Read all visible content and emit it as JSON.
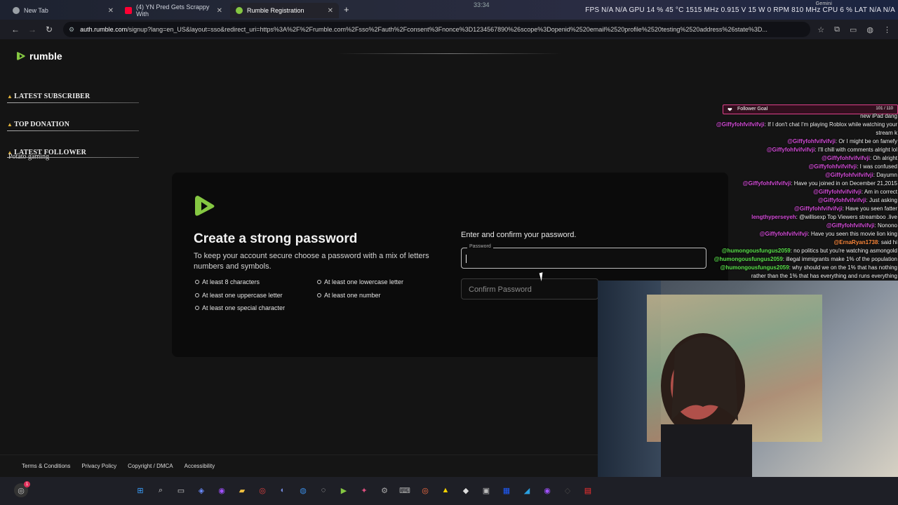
{
  "browser": {
    "tabs": [
      {
        "label": "New Tab",
        "color": "#9aa0a6"
      },
      {
        "label": "(4) YN Pred Gets Scrappy With",
        "color": "#ff0033"
      },
      {
        "label": "Rumble Registration",
        "color": "#85c742"
      }
    ],
    "url_host": "auth.rumble.com",
    "url_path": "/signup?lang=en_US&layout=sso&redirect_uri=https%3A%2F%2Frumble.com%2Fsso%2Fauth%2Fconsent%3Fnonce%3D1234567890%26scope%3Dopenid%2520email%2520profile%2520testing%2520address%26state%3D..."
  },
  "hud": {
    "text": "FPS N/A N/A   GPU 14 %  45 °C  1515 MHz  0.915 V  15 W  0 RPM  810 MHz   CPU  6 %   LAT N/A N/A",
    "gemini": "Gemini",
    "time": "33:34"
  },
  "rumble": {
    "brand": "rumble",
    "accent": "#85c742",
    "title": "Create a strong password",
    "description": "To keep your account secure choose a password with a mix of letters numbers and symbols.",
    "requirements": [
      "At least 8 characters",
      "At least one lowercase letter",
      "At least one uppercase letter",
      "At least one number",
      "At least one special character"
    ],
    "enter_label": "Enter and confirm your password.",
    "password_label": "Password",
    "password_value": "",
    "confirm_placeholder": "Confirm Password",
    "footer_links": [
      "Terms & Conditions",
      "Privacy Policy",
      "Copyright / DMCA",
      "Accessibility"
    ]
  },
  "overlay": {
    "latest_subscriber": "LATEST SUBSCRIBER",
    "top_donation": "TOP DONATION",
    "latest_follower": "LATEST FOLLOWER",
    "latest_follower_value": "Potato gaming"
  },
  "follower_goal": {
    "title": "Follower Goal",
    "count": "101 / 110"
  },
  "chat": [
    {
      "user": "",
      "text": "new iPad dang",
      "color": "#ffffff"
    },
    {
      "user": "@Giffyfohfvifvifvji",
      "text": ": If I don't chat I'm playing Roblox while watching your",
      "color": "#d24bd6"
    },
    {
      "user": "",
      "text": "stream k",
      "color": "#ffffff"
    },
    {
      "user": "@Giffyfohfvifvifvji",
      "text": ": Or I might be on famefy",
      "color": "#d24bd6"
    },
    {
      "user": "@Giffyfohfvifvifvji",
      "text": ": I'll chill with comments alright lol",
      "color": "#d24bd6"
    },
    {
      "user": "@Giffyfohfvifvifvji",
      "text": ": Oh alright",
      "color": "#d24bd6"
    },
    {
      "user": "@Giffyfohfvifvifvji",
      "text": ": I was confused",
      "color": "#d24bd6"
    },
    {
      "user": "@Giffyfohfvifvifvji",
      "text": ": Dayumn",
      "color": "#d24bd6"
    },
    {
      "user": "@Giffyfohfvifvifvji",
      "text": ": Have you joined in on December 21,2015",
      "color": "#d24bd6"
    },
    {
      "user": "@Giffyfohfvifvifvji",
      "text": ": Am in correct",
      "color": "#d24bd6"
    },
    {
      "user": "@Giffyfohfvifvifvji",
      "text": ": Just asking",
      "color": "#d24bd6"
    },
    {
      "user": "@Giffyfohfvifvifvji",
      "text": ": Have you seen fatter",
      "color": "#d24bd6"
    },
    {
      "user": "lengthyperseyeh",
      "text": ": @willisexp Top Viewers streamboo .live",
      "color": "#d24bd6"
    },
    {
      "user": "@Giffyfohfvifvifvji",
      "text": ": Nonono",
      "color": "#d24bd6"
    },
    {
      "user": "@Giffyfohfvifvifvji",
      "text": ": Have you seen this movie lion king",
      "color": "#d24bd6"
    },
    {
      "user": "@ErnaRyan1738",
      "text": ": said hi",
      "color": "#ff8a3d"
    },
    {
      "user": "@humongousfungus2059",
      "text": ": no politics but you're watching asmongold",
      "color": "#59e04a"
    },
    {
      "user": "@humongousfungus2059",
      "text": ": illegal immigrants make 1% of the population",
      "color": "#59e04a"
    },
    {
      "user": "@humongousfungus2059",
      "text": ": why should we on the 1% that has nothing",
      "color": "#59e04a"
    },
    {
      "user": "",
      "text": "rather than the 1% that has everything and runs everything",
      "color": "#ffffff"
    }
  ],
  "taskbar": {
    "notification_count": "1",
    "apps": [
      {
        "name": "windows-start-icon",
        "glyph": "⊞",
        "color": "#3aa0ff"
      },
      {
        "name": "search-icon",
        "glyph": "⌕",
        "color": "#cccccc"
      },
      {
        "name": "task-view-icon",
        "glyph": "▭",
        "color": "#cccccc"
      },
      {
        "name": "copilot-icon",
        "glyph": "◈",
        "color": "#6b8cff"
      },
      {
        "name": "twitch-like-icon",
        "glyph": "◉",
        "color": "#a050ff"
      },
      {
        "name": "file-explorer-icon",
        "glyph": "▰",
        "color": "#f0c040"
      },
      {
        "name": "chrome-icon",
        "glyph": "◎",
        "color": "#e04040"
      },
      {
        "name": "discord-icon",
        "glyph": "◐",
        "color": "#7289da"
      },
      {
        "name": "steam-icon",
        "glyph": "◍",
        "color": "#3a8ae0"
      },
      {
        "name": "obs-icon",
        "glyph": "◌",
        "color": "#cccccc"
      },
      {
        "name": "rumble-app-icon",
        "glyph": "▶",
        "color": "#85c742"
      },
      {
        "name": "game-icon",
        "glyph": "✦",
        "color": "#e05080"
      },
      {
        "name": "settings-icon",
        "glyph": "⚙",
        "color": "#aaaaaa"
      },
      {
        "name": "terminal-icon",
        "glyph": "⌨",
        "color": "#aaaaaa"
      },
      {
        "name": "browser-alt-icon",
        "glyph": "◎",
        "color": "#ff7043"
      },
      {
        "name": "notification-app-icon",
        "glyph": "▲",
        "color": "#f5d300"
      },
      {
        "name": "github-icon",
        "glyph": "◆",
        "color": "#dddddd"
      },
      {
        "name": "capture-icon",
        "glyph": "▣",
        "color": "#bbbbbb"
      },
      {
        "name": "photoshop-icon",
        "glyph": "▦",
        "color": "#1e5cff"
      },
      {
        "name": "media-icon",
        "glyph": "◢",
        "color": "#2aa0e0"
      },
      {
        "name": "stream-icon",
        "glyph": "◉",
        "color": "#a050ff"
      },
      {
        "name": "vpn-icon",
        "glyph": "◇",
        "color": "#444444"
      },
      {
        "name": "misc-icon",
        "glyph": "▤",
        "color": "#ff3030"
      }
    ]
  }
}
